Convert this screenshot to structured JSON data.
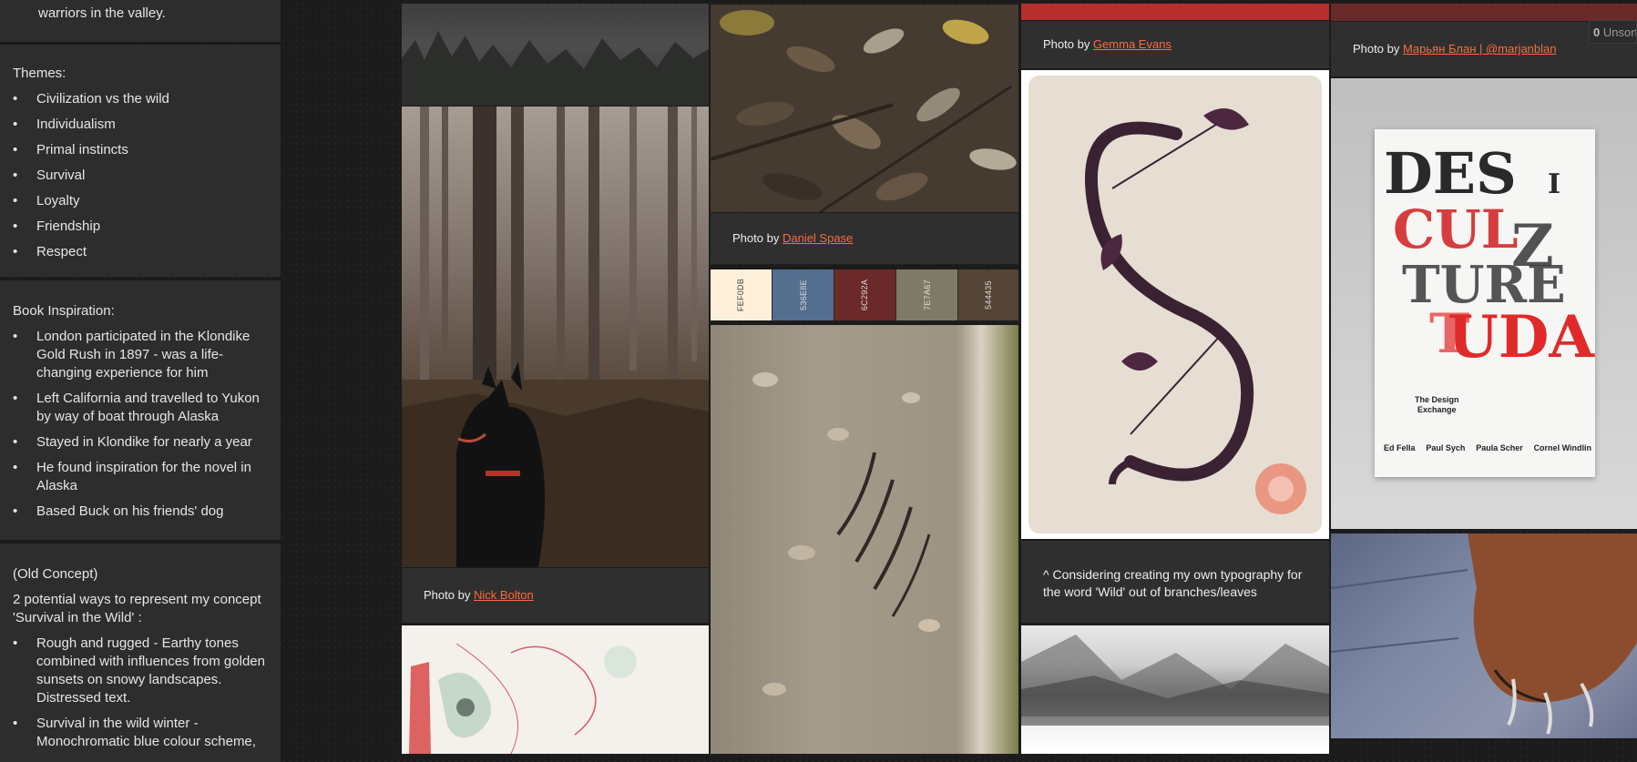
{
  "notes": {
    "intro_tail": "warriors in the valley.",
    "themes_title": "Themes:",
    "themes": [
      "Civilization vs the wild",
      "Individualism",
      "Primal instincts",
      "Survival",
      "Loyalty",
      "Friendship",
      "Respect"
    ],
    "inspiration_title": "Book Inspiration:",
    "inspiration": [
      "London participated in the Klondike Gold Rush in 1897 - was a life-changing experience for him",
      "Left California and travelled to Yukon by way of boat through Alaska",
      "Stayed in Klondike for nearly a year",
      "He found inspiration for the novel in Alaska",
      "Based Buck on his friends' dog"
    ],
    "old_concept_title": "(Old Concept)",
    "old_concept_intro": "2 potential ways to represent my concept 'Survival in the Wild' :",
    "old_concept_items": [
      "Rough and rugged - Earthy tones combined with influences from golden sunsets on snowy landscapes. Distressed text.",
      "Survival in the wild winter - Monochromatic blue colour scheme,"
    ]
  },
  "captions": {
    "photo_by": "Photo by",
    "nick": "Nick Bolton",
    "daniel": "Daniel Spase",
    "gemma": "Gemma Evans",
    "marjan": "Марьян Блан | @marjanblan",
    "typography_note": "^ Considering creating my own typography for the word 'Wild' out of branches/leaves"
  },
  "palette": [
    {
      "hex": "FEF0DB",
      "color": "#FEF0DB",
      "text": "#444444"
    },
    {
      "hex": "536E8E",
      "color": "#536E8E",
      "text": "#dddddd"
    },
    {
      "hex": "6C292A",
      "color": "#6C292A",
      "text": "#dddddd"
    },
    {
      "hex": "7E7A67",
      "color": "#7E7A67",
      "text": "#dddddd"
    },
    {
      "hex": "544435",
      "color": "#544435",
      "text": "#dddddd"
    }
  ],
  "poster": {
    "line1": "The Design",
    "line2": "Exchange",
    "names": [
      "Ed Fella",
      "Paul Sych",
      "Paula Scher",
      "Cornel Windlin"
    ]
  },
  "unsorted": {
    "count": "0",
    "label": "Unsort"
  }
}
